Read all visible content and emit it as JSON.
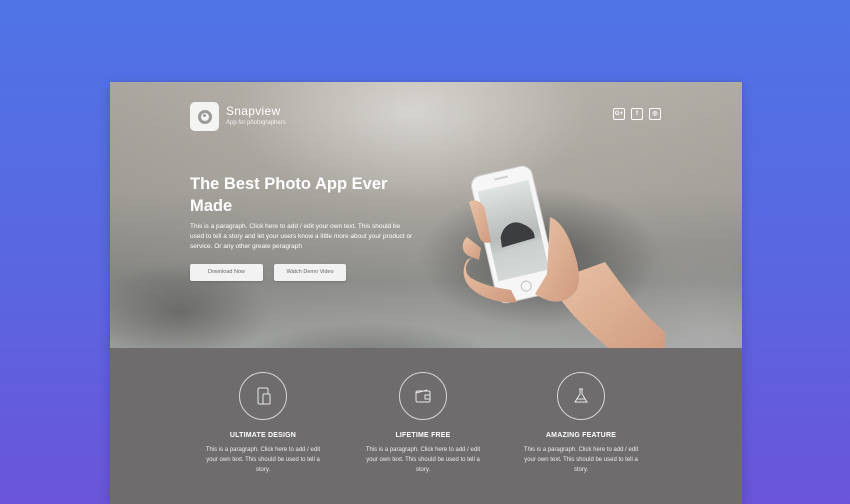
{
  "brand": {
    "name": "Snapview",
    "tagline": "App for photographers"
  },
  "social_icons": [
    "google-plus-icon",
    "facebook-icon",
    "instagram-icon"
  ],
  "social_glyphs": [
    "G+",
    "f",
    "◎"
  ],
  "hero": {
    "headline": "The Best Photo App Ever Made",
    "paragraph": "This is a paragraph. Click here to add / edit your own text. This should be used to tell a story and let your users know a little more about your product or service. Or any other greate peragraph",
    "download_label": "Download Now",
    "demo_label": "Watch Demo Video"
  },
  "features": [
    {
      "icon": "devices-icon",
      "title": "ULTIMATE DESIGN",
      "text": "This is a paragraph. Click here to add / edit your own text. This should be used to tell a story."
    },
    {
      "icon": "wallet-icon",
      "title": "LIFETIME FREE",
      "text": "This is a paragraph. Click here to add / edit your own text. This should be used to tell a story."
    },
    {
      "icon": "flask-icon",
      "title": "AMAZING FEATURE",
      "text": "This is a paragraph. Click here to add / edit your own text. This should be used to tell a story."
    }
  ],
  "colors": {
    "background_top": "#4f74e6",
    "background_bottom": "#6a55d8",
    "features_bg": "#6e6c6c",
    "button_bg": "#f2f2f2"
  }
}
